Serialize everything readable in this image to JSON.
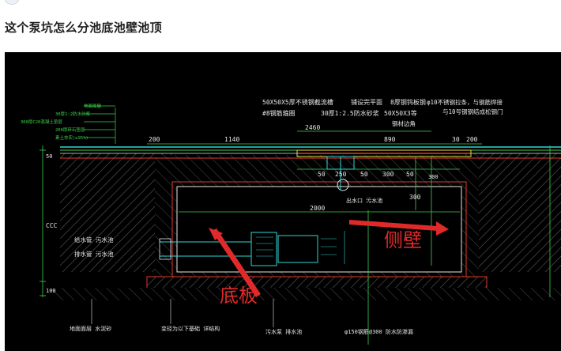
{
  "question": {
    "title": "这个泵坑怎么分池底池壁池顶"
  },
  "drawing": {
    "top_notes": {
      "note_a": "50X50X5厚不锈钢截流槽",
      "note_b": "铺设完平面",
      "note_c": "8厚钢钨板钢",
      "note_d": "φ10不锈钢拉条，与钢筋焊接",
      "note_e": "与10号钢钢结成松钢门",
      "note_f": "#8钢筋箍圈",
      "note_g": "30厚1:2.5防水砂浆",
      "note_h": "50X50X3等",
      "note_i": "钢材边角"
    },
    "left_notes": [
      "地面面层",
      "30厚1:2防水砂浆",
      "300厚C20混凝土垫层",
      "200厚碎石垫层",
      "素土夯实(≥95%)"
    ],
    "dimensions": {
      "d2460": "2460",
      "d200a": "200",
      "d1140": "1140",
      "d890": "890",
      "d30": "30",
      "d200b": "200",
      "d50a": "50",
      "d250": "250",
      "d50b": "50",
      "d300": "300",
      "d50c": "50",
      "d300v": "300",
      "d2000": "2000",
      "d50v": "50",
      "dCCC": "CCC",
      "d100": "100",
      "d300r": "300"
    },
    "mid_labels": {
      "outlet": "出水口  污水池",
      "inlet_top": "给水管  污水池",
      "inlet_bottom": "排水管  污水池"
    },
    "bottom_labels": {
      "b1": "地面面层  水泥砂",
      "b2": "变径为以下基础  详结构",
      "b3": "污水泵  排水池",
      "b4": "φ150钢筋@300  防水防渗漏"
    },
    "annotations": {
      "bottom_slab": "底板",
      "side_wall": "侧壁"
    },
    "colors": {
      "annotation_red": "#e02a2a",
      "cad_green": "#3cd24a",
      "cad_white": "#e6e6e6",
      "cad_cyan": "#2fd6d6",
      "cad_yellow": "#e8e04a",
      "cad_red": "#e23a2e"
    }
  }
}
